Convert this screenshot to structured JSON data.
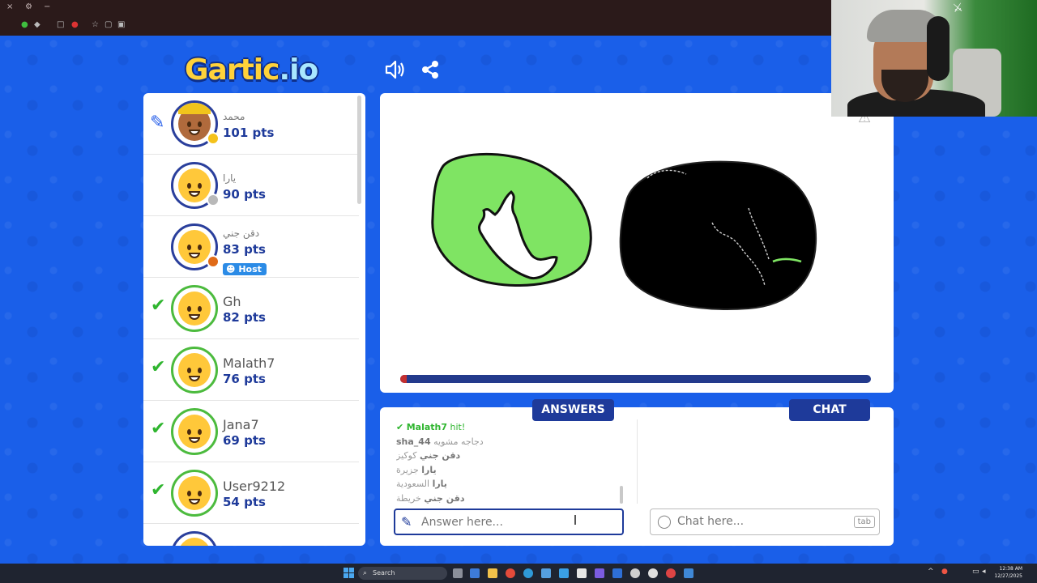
{
  "app": {
    "logo_part1": "Gartic",
    "logo_part2": ".io"
  },
  "browser": {
    "window_controls": [
      "×",
      "⚙",
      "−"
    ]
  },
  "icons": {
    "sound": "speaker-icon",
    "share": "share-icon",
    "draw": "pencil-icon",
    "guessed": "check-icon",
    "report": "warning-icon",
    "chat": "chat-bubble-icon"
  },
  "players": [
    {
      "name": "محمد",
      "points": "101 pts",
      "marker": "pencil",
      "status_color": "#f4c21b",
      "avatar": "cap"
    },
    {
      "name": "يارا",
      "points": "90 pts",
      "marker": "none",
      "status_color": "#b9b9b9",
      "avatar": "plain"
    },
    {
      "name": "دقن جني",
      "points": "83 pts",
      "marker": "none",
      "status_color": "#e06a17",
      "avatar": "plain",
      "badge": "Host"
    },
    {
      "name": "Gh",
      "points": "82 pts",
      "marker": "check",
      "avatar": "plain"
    },
    {
      "name": "Malath7",
      "points": "76 pts",
      "marker": "check",
      "avatar": "plain"
    },
    {
      "name": "Jana7",
      "points": "69 pts",
      "marker": "check",
      "avatar": "plain"
    },
    {
      "name": "User9212",
      "points": "54 pts",
      "marker": "check",
      "avatar": "plain"
    }
  ],
  "host_badge": {
    "icon": "smiley-icon",
    "label": "Host"
  },
  "tabs": {
    "answers": "ANSWERS",
    "chat": "CHAT"
  },
  "answers": [
    {
      "who": "Malath7",
      "text": "hit!",
      "hit": true
    },
    {
      "who": "sha_44",
      "text": "دجاجه مشويه",
      "hit": false
    },
    {
      "who": "دقن جني",
      "text": "كوكيز",
      "hit": false
    },
    {
      "who": "يارا",
      "text": "جزيرة",
      "hit": false
    },
    {
      "who": "يارا",
      "text": "السعودية",
      "hit": false
    },
    {
      "who": "دقن جني",
      "text": "خريطة",
      "hit": false
    }
  ],
  "inputs": {
    "answer_placeholder": "Answer here...",
    "chat_placeholder": "Chat here...",
    "chat_shortcut": "tab"
  },
  "timer": {
    "remaining_fraction": 0.99
  },
  "colors": {
    "background": "#1a5ee8",
    "navy": "#1e3a9a",
    "hit_green": "#2fb52f",
    "drawing_green": "#7fe463"
  },
  "taskbar": {
    "search_label": "Search",
    "time": "12:38 AM",
    "date": "12/27/2025"
  }
}
